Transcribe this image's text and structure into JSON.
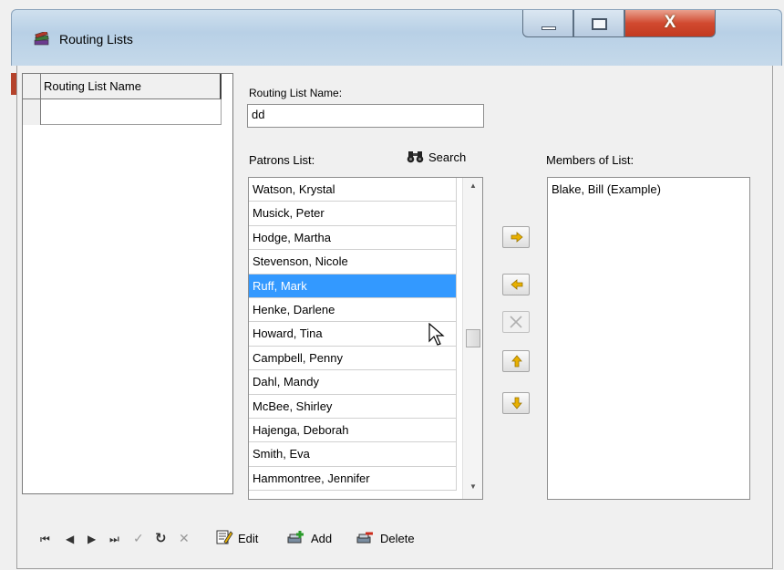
{
  "window": {
    "title": "Routing Lists",
    "close_glyph": "X"
  },
  "grid": {
    "header": "Routing List Name",
    "rows": [
      ""
    ]
  },
  "form": {
    "routing_name_label": "Routing List Name:",
    "routing_name_value": "dd",
    "patrons_label": "Patrons List:",
    "search_label": "Search",
    "members_label": "Members of List:"
  },
  "patrons": [
    "Watson, Krystal",
    "Musick, Peter",
    "Hodge, Martha",
    "Stevenson, Nicole",
    "Ruff, Mark",
    "Henke, Darlene",
    "Howard, Tina",
    "Campbell, Penny",
    "Dahl, Mandy",
    "McBee, Shirley",
    "Hajenga, Deborah",
    "Smith, Eva",
    "Hammontree, Jennifer"
  ],
  "selected_patron": "Ruff, Mark",
  "members": [
    "Blake, Bill (Example)"
  ],
  "toolbar": {
    "nav_first": "⏮",
    "nav_prev": "◀",
    "nav_next": "▶",
    "nav_last": "⏭",
    "confirm": "✓",
    "refresh": "↻",
    "cancel": "✕",
    "edit_label": "Edit",
    "add_label": "Add",
    "delete_label": "Delete"
  },
  "colors": {
    "selection": "#3399ff",
    "arrow_icon": "#e8b000",
    "close_button": "#c8402a"
  },
  "icons": {
    "app": "books-icon",
    "search": "binoculars-icon",
    "move_right": "arrow-right-icon",
    "move_left": "arrow-left-icon",
    "remove": "x-icon",
    "move_up": "arrow-up-icon",
    "move_down": "arrow-down-icon"
  }
}
